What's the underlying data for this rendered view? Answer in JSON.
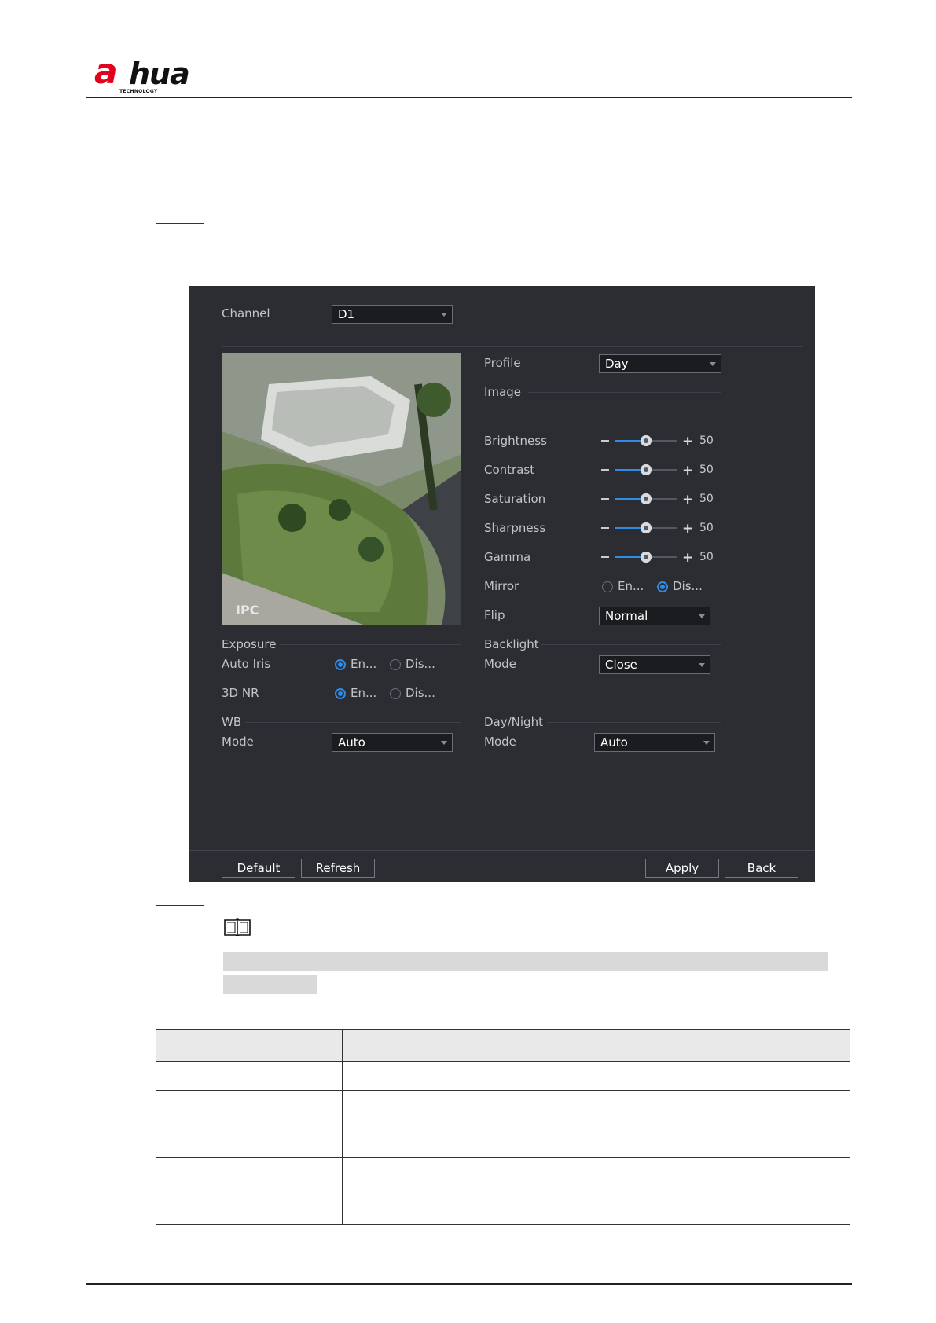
{
  "header": {
    "brand_a": "a",
    "brand_rest": "hua",
    "brand_sub": "TECHNOLOGY"
  },
  "screen": {
    "channel_label": "Channel",
    "channel_value": "D1",
    "profile_label": "Profile",
    "profile_value": "Day",
    "image_section": "Image",
    "preview_overlay": "IPC",
    "sliders": [
      {
        "label": "Brightness",
        "value": 50
      },
      {
        "label": "Contrast",
        "value": 50
      },
      {
        "label": "Saturation",
        "value": 50
      },
      {
        "label": "Sharpness",
        "value": 50
      },
      {
        "label": "Gamma",
        "value": 50
      }
    ],
    "mirror": {
      "label": "Mirror",
      "opt1": "En...",
      "opt2": "Dis...",
      "selected": "opt2"
    },
    "flip": {
      "label": "Flip",
      "value": "Normal"
    },
    "exposure_section": "Exposure",
    "auto_iris": {
      "label": "Auto Iris",
      "opt1": "En...",
      "opt2": "Dis...",
      "selected": "opt1"
    },
    "nr3d": {
      "label": "3D NR",
      "opt1": "En...",
      "opt2": "Dis...",
      "selected": "opt1"
    },
    "backlight_section": "Backlight",
    "backlight_mode": {
      "label": "Mode",
      "value": "Close"
    },
    "wb_section": "WB",
    "wb_mode": {
      "label": "Mode",
      "value": "Auto"
    },
    "daynight_section": "Day/Night",
    "daynight_mode": {
      "label": "Mode",
      "value": "Auto"
    },
    "buttons": {
      "default": "Default",
      "refresh": "Refresh",
      "apply": "Apply",
      "back": "Back"
    }
  },
  "colors": {
    "accent": "#2f8be6",
    "panel_bg": "#2b2d33",
    "brand_red": "#e6001f"
  }
}
